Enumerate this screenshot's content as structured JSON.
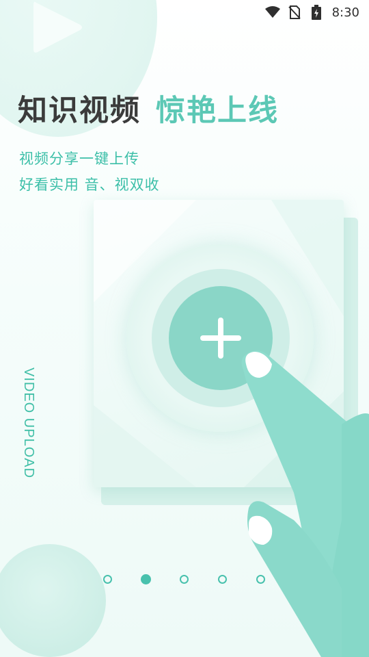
{
  "status_bar": {
    "time": "8:30",
    "icons": [
      "wifi-icon",
      "no-sim-icon",
      "battery-charging-icon"
    ]
  },
  "intro": {
    "title_dark": "知识视频",
    "title_accent": "惊艳上线",
    "subtitle_line1": "视频分享一键上传",
    "subtitle_line2": "好看实用 音、视双收",
    "vertical_label": "VIDEO UPLOAD"
  },
  "illustration": {
    "icons": [
      "play-icon",
      "add-icon",
      "pointing-hand"
    ]
  },
  "pager": {
    "total": 5,
    "active_index": 1
  },
  "colors": {
    "accent": "#5cc8b5",
    "accent_dark": "#48c1ad",
    "title_dark": "#3b3b3b",
    "button": "#8ad6c7"
  }
}
